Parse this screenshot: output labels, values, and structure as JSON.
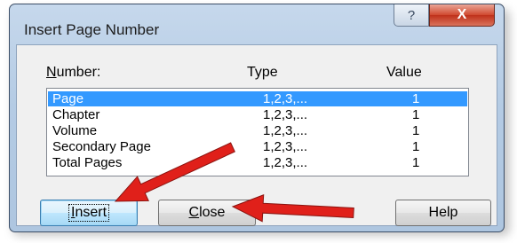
{
  "window": {
    "title": "Insert Page Number",
    "help_glyph": "?",
    "close_glyph": "X"
  },
  "list": {
    "headers": {
      "number_accel": "N",
      "number_rest": "umber:",
      "type": "Type",
      "value": "Value"
    },
    "rows": [
      {
        "name": "Page",
        "type": "1,2,3,...",
        "value": "1",
        "selected": true
      },
      {
        "name": "Chapter",
        "type": "1,2,3,...",
        "value": "1",
        "selected": false
      },
      {
        "name": "Volume",
        "type": "1,2,3,...",
        "value": "1",
        "selected": false
      },
      {
        "name": "Secondary Page",
        "type": "1,2,3,...",
        "value": "1",
        "selected": false
      },
      {
        "name": "Total Pages",
        "type": "1,2,3,...",
        "value": "1",
        "selected": false
      }
    ]
  },
  "buttons": {
    "insert": {
      "accel": "I",
      "rest": "nsert"
    },
    "close": {
      "accel": "C",
      "rest": "lose"
    },
    "help": "Help"
  },
  "annotations": {
    "arrow_color": "#e0201a",
    "arrow_count": 2
  }
}
